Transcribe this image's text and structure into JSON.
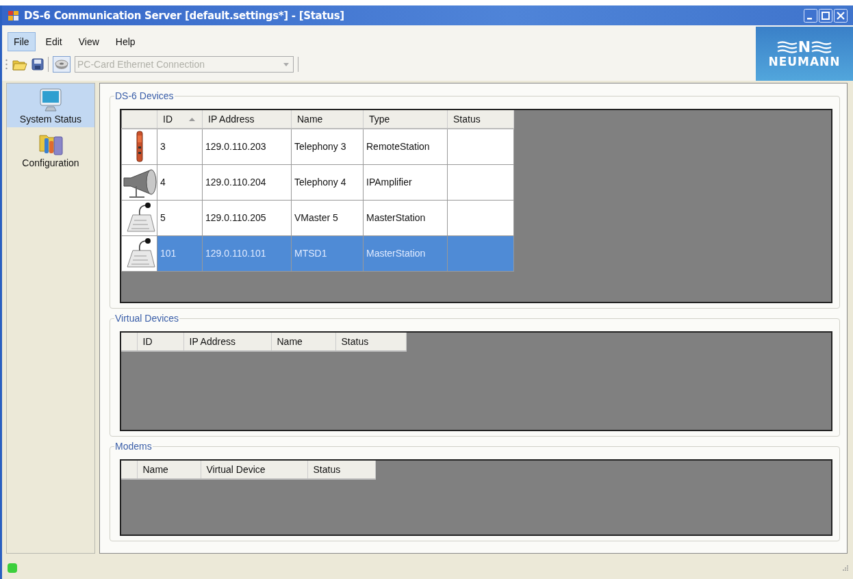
{
  "window": {
    "title": "DS-6 Communication Server [default.settings*] - [Status]"
  },
  "menu": [
    {
      "label": "File",
      "selected": true
    },
    {
      "label": "Edit",
      "selected": false
    },
    {
      "label": "View",
      "selected": false
    },
    {
      "label": "Help",
      "selected": false
    }
  ],
  "toolbar": {
    "connection": {
      "value": "PC-Card Ethernet Connection",
      "disabled": true
    }
  },
  "logo": {
    "mark": "N",
    "name": "NEUMANN"
  },
  "sidebar": {
    "items": [
      {
        "label": "System Status",
        "kind": "monitor",
        "selected": true
      },
      {
        "label": "Configuration",
        "kind": "config",
        "selected": false
      }
    ]
  },
  "groups": [
    {
      "title": "DS-6 Devices",
      "columns": [
        {
          "label": "ID",
          "sorted": true
        },
        {
          "label": "IP Address",
          "sorted": false
        },
        {
          "label": "Name",
          "sorted": false
        },
        {
          "label": "Type",
          "sorted": false
        },
        {
          "label": "Status",
          "sorted": false
        }
      ],
      "rows": [
        {
          "kind": "remote",
          "selected": false,
          "cells": [
            "3",
            "129.0.110.203",
            "Telephony 3",
            "RemoteStation"
          ]
        },
        {
          "kind": "amplifier",
          "selected": false,
          "cells": [
            "4",
            "129.0.110.204",
            "Telephony 4",
            "IPAmplifier"
          ]
        },
        {
          "kind": "master",
          "selected": false,
          "cells": [
            "5",
            "129.0.110.205",
            "VMaster 5",
            "MasterStation"
          ]
        },
        {
          "kind": "master",
          "selected": true,
          "cells": [
            "101",
            "129.0.110.101",
            "MTSD1",
            "MasterStation"
          ]
        }
      ]
    },
    {
      "title": "Virtual Devices",
      "columns": [
        {
          "label": "ID",
          "sorted": false
        },
        {
          "label": "IP Address",
          "sorted": false
        },
        {
          "label": "Name",
          "sorted": false
        },
        {
          "label": "Status",
          "sorted": false
        }
      ]
    },
    {
      "title": "Modems",
      "columns": [
        {
          "label": "Name",
          "sorted": false
        },
        {
          "label": "Virtual Device",
          "sorted": false
        },
        {
          "label": "Status",
          "sorted": false
        }
      ]
    }
  ],
  "status_bar": {
    "indicator": {
      "color": "#3ccf3c"
    }
  }
}
